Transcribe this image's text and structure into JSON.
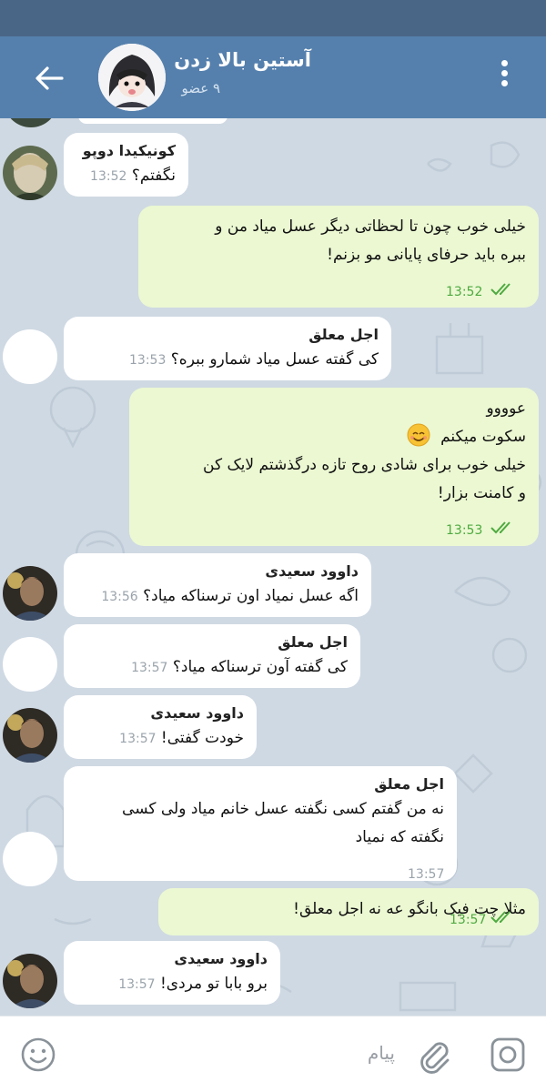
{
  "header": {
    "title": "آستین بالا زدن",
    "subtitle": "۹ عضو"
  },
  "messages": [
    {
      "sender": "کونیکیدا دوپو",
      "text": "نگفتم؟",
      "time": "13:52"
    },
    {
      "text": "خیلی خوب چون تا لحظاتی دیگر عسل میاد من و",
      "text2": "ببره باید حرفای پایانی مو بزنم!",
      "time": "13:52"
    },
    {
      "sender": "اجل معلق",
      "text": "کی گفته عسل میاد شمارو ببره؟",
      "time": "13:53"
    },
    {
      "line1": "عوووو",
      "line2": "سکوت میکنم",
      "line3": "خیلی خوب برای شادی روح تازه درگذشتم لایک کن",
      "line4": "و کامنت بزار!",
      "time": "13:53"
    },
    {
      "sender": "داوود سعیدی",
      "text": "اگه عسل نمیاد اون ترسناکه میاد؟",
      "time": "13:56"
    },
    {
      "sender": "اجل معلق",
      "text": "کی گفته آون ترسناکه میاد؟",
      "time": "13:57"
    },
    {
      "sender": "داوود سعیدی",
      "text": "خودت گفتی!",
      "time": "13:57"
    },
    {
      "sender": "اجل معلق",
      "text": "نه من گفتم کسی نگفته عسل خانم میاد ولی کسی",
      "text2": "نگفته که نمیاد",
      "time": "13:57"
    },
    {
      "text": "مثلا چت فیک بانگو عه نه اجل معلق!",
      "time": "13:57"
    },
    {
      "sender": "داوود سعیدی",
      "text": "برو بابا تو مردی!",
      "time": "13:57"
    }
  ],
  "input": {
    "placeholder": "پیام"
  },
  "colors": {
    "header": "#5580ad",
    "status_bar": "#4a6686",
    "chat_bg": "#cfd9e3",
    "incoming_bubble": "#ffffff",
    "outgoing_bubble": "#ebf8d2",
    "outgoing_time": "#4faa40"
  },
  "icons": [
    "back-arrow-icon",
    "more-vert-icon",
    "emoji-icon",
    "attach-icon",
    "camera-icon",
    "double-check-icon"
  ]
}
